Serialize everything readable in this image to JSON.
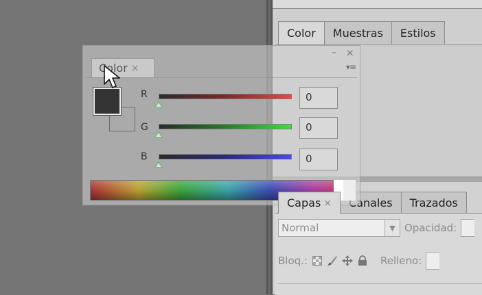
{
  "dock_top": {
    "tabs": [
      {
        "label": "Color",
        "active": true
      },
      {
        "label": "Muestras",
        "active": false
      },
      {
        "label": "Estilos",
        "active": false
      }
    ]
  },
  "dock_layers": {
    "tabs": [
      {
        "label": "Capas",
        "active": true,
        "close": "×"
      },
      {
        "label": "Canales",
        "active": false
      },
      {
        "label": "Trazados",
        "active": false
      }
    ],
    "blend_mode": "Normal",
    "opacity_label": "Opacidad:",
    "lock_label": "Bloq.:",
    "fill_label": "Relleno:"
  },
  "floating_panel": {
    "tab_label": "Color",
    "tab_close": "×",
    "minimize": "–",
    "close": "×",
    "menu": "▾≡",
    "channels": [
      {
        "label": "R",
        "value": "0",
        "color": "#e84848"
      },
      {
        "label": "G",
        "value": "0",
        "color": "#48d848"
      },
      {
        "label": "B",
        "value": "0",
        "color": "#4848e8"
      }
    ],
    "foreground_color": "#333333"
  }
}
